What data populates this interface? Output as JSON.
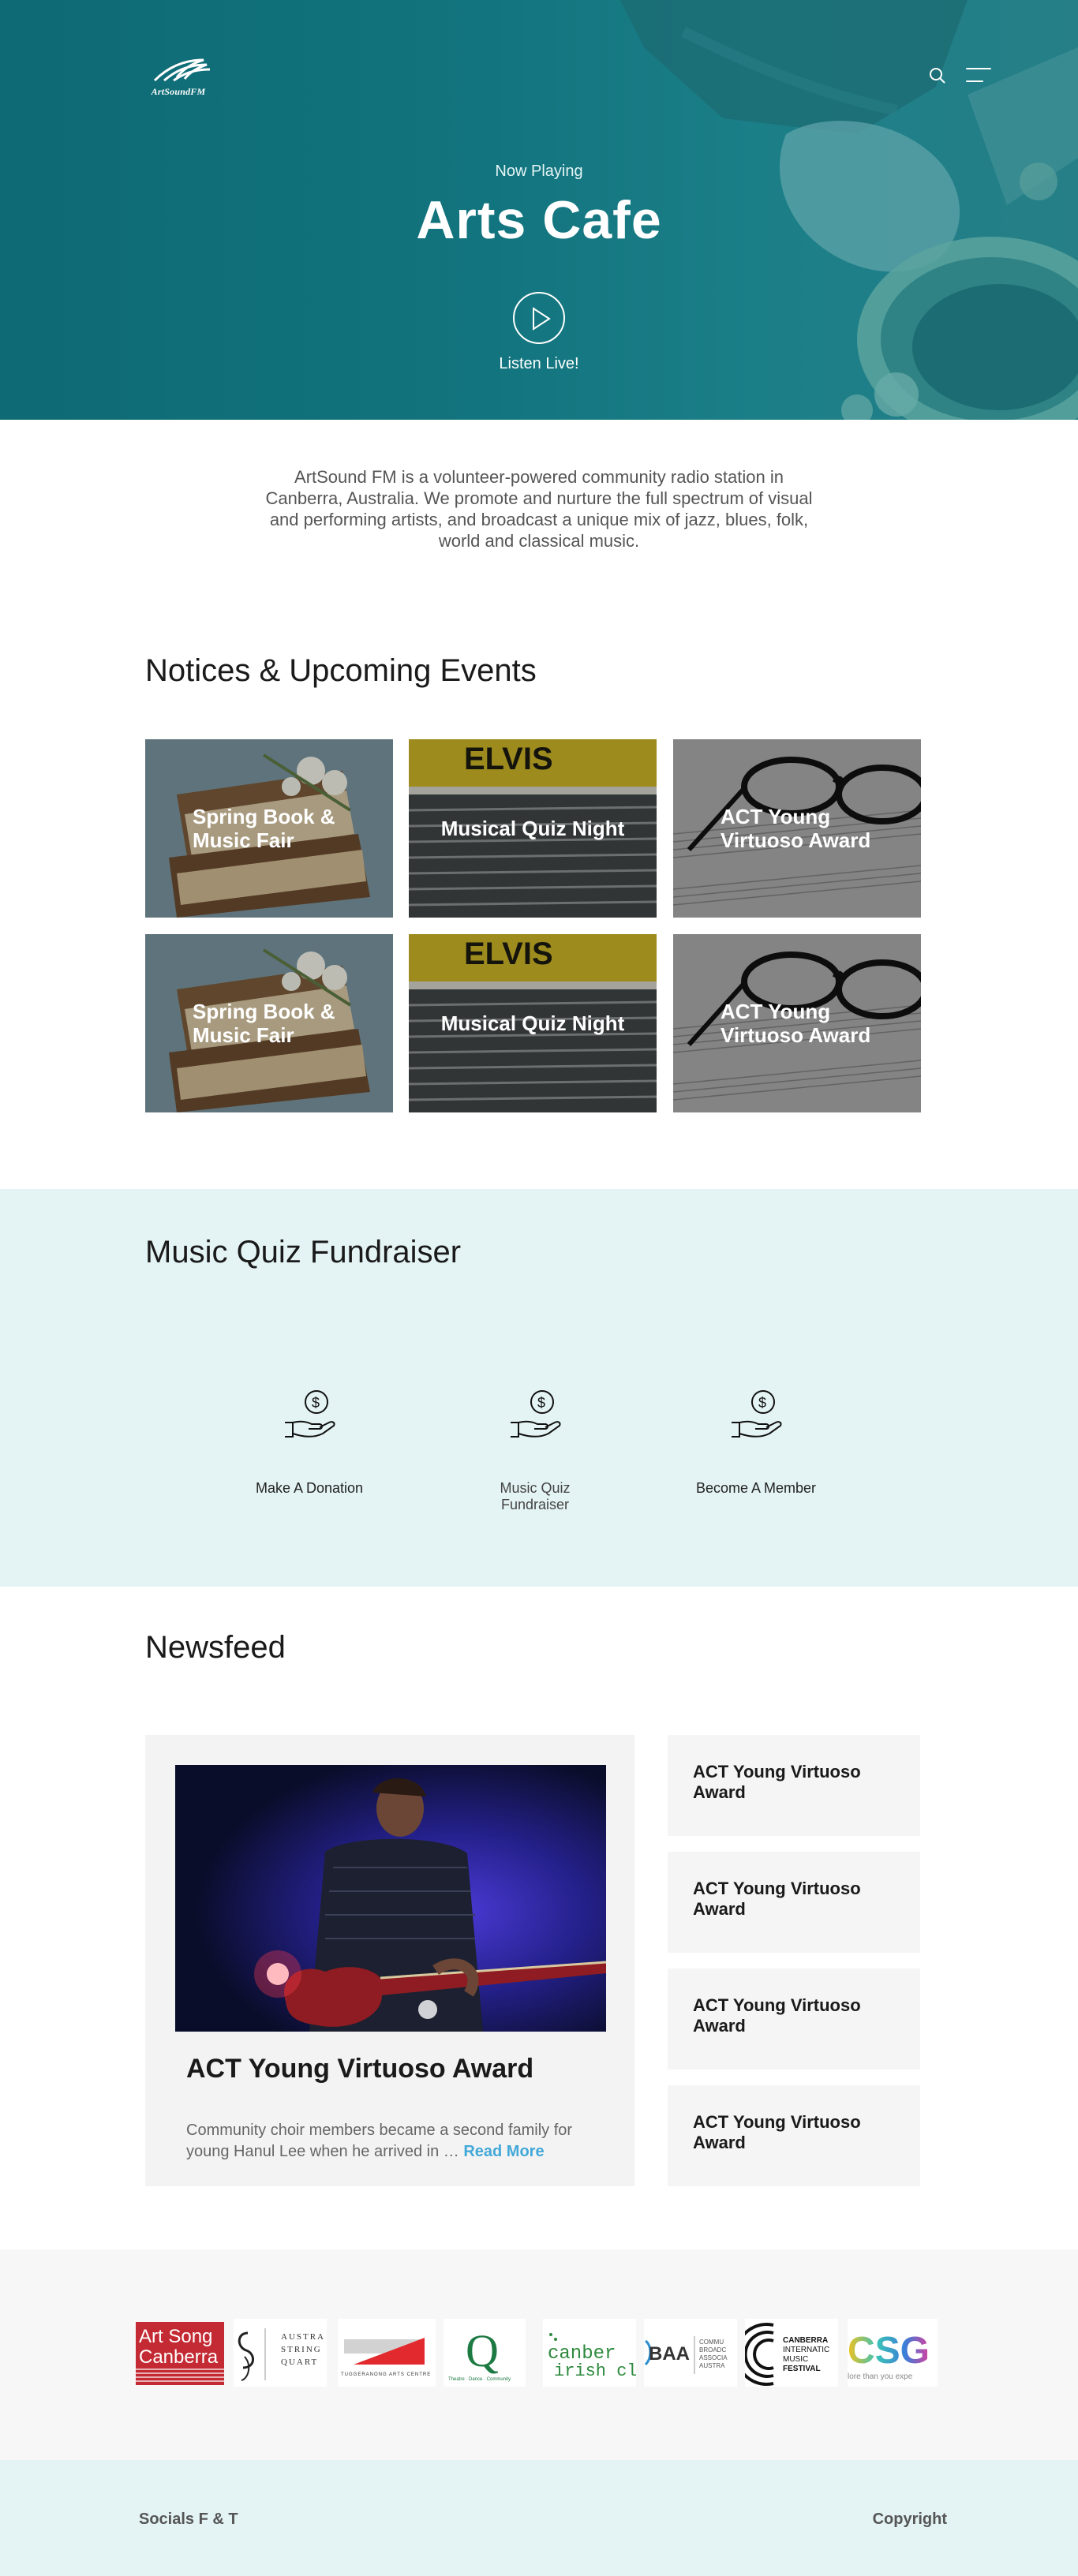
{
  "brand": {
    "name": "ArtSoundFM"
  },
  "hero": {
    "now_playing_label": "Now Playing",
    "show_title": "Arts Cafe",
    "listen_label": "Listen Live!"
  },
  "intro": {
    "text": "ArtSound FM is a volunteer-powered community radio station in Canberra, Australia. We promote and nurture the full spectrum of visual and performing artists, and broadcast a unique mix of jazz, blues, folk, world and classical music."
  },
  "events": {
    "title": "Notices & Upcoming Events",
    "items": [
      {
        "label": "Spring Book & Music Fair"
      },
      {
        "label": "Musical Quiz Night"
      },
      {
        "label": "ACT Young Virtuoso Award"
      },
      {
        "label": "Spring Book & Music Fair"
      },
      {
        "label": "Musical Quiz Night"
      },
      {
        "label": "ACT Young Virtuoso Award"
      }
    ],
    "poster_text": "ELVIS"
  },
  "fundraiser": {
    "title": "Music Quiz Fundraiser",
    "items": [
      {
        "label": "Make A Donation",
        "icon": "donation-hand-icon"
      },
      {
        "label": "Music Quiz Fundraiser",
        "icon": "donation-hand-icon"
      },
      {
        "label": "Become A Member",
        "icon": "donation-hand-icon"
      }
    ]
  },
  "newsfeed": {
    "title": "Newsfeed",
    "featured": {
      "headline": "ACT Young Virtuoso Award",
      "body": "Community choir members became a second family for young Hanul Lee when he arrived in …",
      "read_more": "Read More"
    },
    "side_items": [
      {
        "label": "ACT Young Virtuoso Award"
      },
      {
        "label": "ACT Young Virtuoso Award"
      },
      {
        "label": "ACT Young Virtuoso Award"
      },
      {
        "label": "ACT Young Virtuoso Award"
      }
    ]
  },
  "partners": {
    "logos": [
      {
        "name": "Art Song Canberra",
        "line1": "Art Song",
        "line2": "Canberra"
      },
      {
        "name": "Australian String Quartet",
        "line1": "AUSTRA",
        "line2": "STRING",
        "line3": "QUART"
      },
      {
        "name": "Tuggeranong Arts Centre",
        "line1": "TUGGERANONG ARTS CENTRE"
      },
      {
        "name": "Q Theatre",
        "line1": "Q",
        "line2": "Theatre · Dance · Community"
      },
      {
        "name": "Canberra Irish Club",
        "line1": "canber",
        "line2": "irish cl"
      },
      {
        "name": "CBAA",
        "line1": "BAA",
        "line2": "COMMU",
        "line3": "BROADC",
        "line4": "ASSOCIA",
        "line5": "AUSTRA"
      },
      {
        "name": "Canberra International Music Festival",
        "line1": "CANBERRA",
        "line2": "INTERNATIC",
        "line3": "MUSIC",
        "line4": "FESTIVAL"
      },
      {
        "name": "CSG",
        "line1": "CSG",
        "line2": "lore than you expe"
      }
    ]
  },
  "footer": {
    "left": "Socials F & T",
    "right": "Copyright"
  },
  "colors": {
    "hero_teal": "#12707a",
    "fund_bg": "#e4f3f4",
    "link_blue": "#42a8d8"
  }
}
